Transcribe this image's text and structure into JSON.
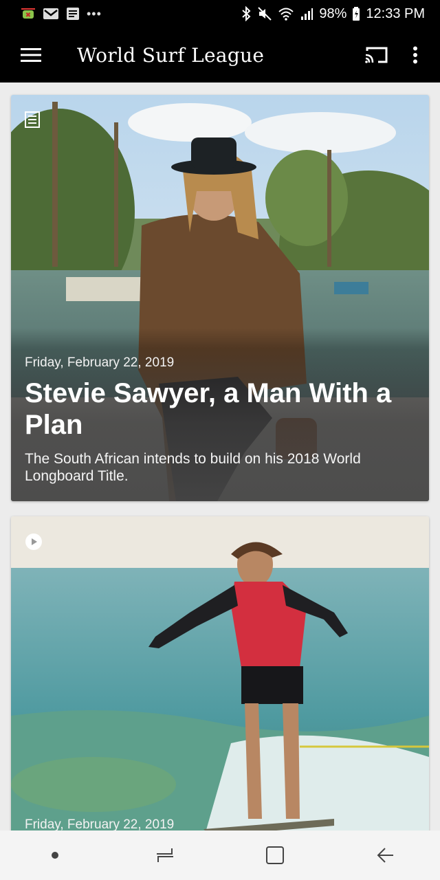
{
  "status_bar": {
    "battery": "98%",
    "time": "12:33 PM",
    "more_indicator": "•••",
    "icons": [
      "android-debug-icon",
      "gmail-icon",
      "news-icon",
      "bluetooth-icon",
      "mute-icon",
      "wifi-icon",
      "signal-icon",
      "battery-icon"
    ]
  },
  "app_bar": {
    "title": "World Surf League",
    "icons": [
      "menu-icon",
      "cast-icon",
      "more-vert-icon"
    ]
  },
  "feed": {
    "cards": [
      {
        "type_icon": "article-icon",
        "date": "Friday, February 22, 2019",
        "headline": "Stevie Sawyer, a Man With a Plan",
        "summary": "The South African intends to build on his 2018 World Longboard Title."
      },
      {
        "type_icon": "video-play-icon",
        "date": "Friday, February 22, 2019"
      }
    ]
  },
  "nav_bar": {
    "icons": [
      "dot-icon",
      "recents-icon",
      "home-icon",
      "back-icon"
    ]
  },
  "colors": {
    "app_bar_bg": "#000000",
    "feed_bg": "#ececec",
    "nav_bar_bg": "#f4f4f4"
  }
}
